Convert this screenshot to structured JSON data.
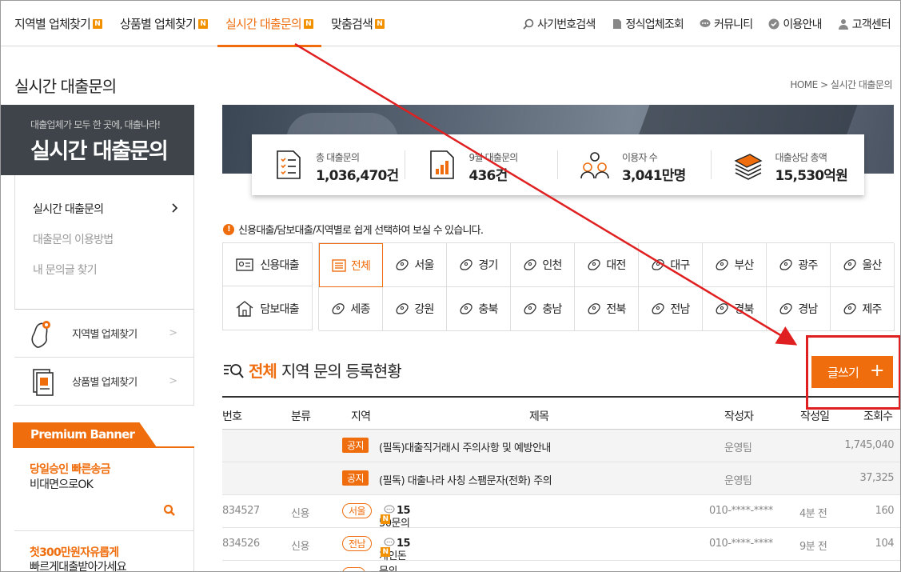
{
  "nav": {
    "main": [
      {
        "label": "지역별 업체찾기",
        "badge": "N"
      },
      {
        "label": "상품별 업체찾기",
        "badge": "N"
      },
      {
        "label": "실시간 대출문의",
        "badge": "N"
      },
      {
        "label": "맞춤검색",
        "badge": "N"
      }
    ],
    "utility": [
      "사기번호검색",
      "정식업체조회",
      "커뮤니티",
      "이용안내",
      "고객센터"
    ]
  },
  "page": {
    "title": "실시간 대출문의",
    "breadcrumb": "HOME > 실시간 대출문의"
  },
  "sidebar": {
    "hero_sub": "대출업체가 모두 한 곳에, 대출나라!",
    "hero_title": "실시간 대출문의",
    "menu": [
      "실시간 대출문의",
      "대출문의 이용방법",
      "내 문의글 찾기"
    ],
    "links": [
      "지역별 업체찾기",
      "상품별 업체찾기"
    ],
    "premium_label": "Premium Banner",
    "promos": [
      {
        "title": "당일승인 빠른송금",
        "sub": "비대면으로OK"
      },
      {
        "title": "첫300만원자유롭게",
        "sub": "빠르게대출받아가세요"
      }
    ]
  },
  "stats": [
    {
      "label": "총 대출문의",
      "value": "1,036,470건"
    },
    {
      "label": "9월 대출문의",
      "value": "436건"
    },
    {
      "label": "이용자 수",
      "value": "3,041만명"
    },
    {
      "label": "대출상담 총액",
      "value": "15,530억원"
    }
  ],
  "info_text": "신용대출/담보대출/지역별로 쉽게 선택하여 보실 수 있습니다.",
  "categories": [
    "신용대출",
    "담보대출"
  ],
  "regions": [
    "전체",
    "서울",
    "경기",
    "인천",
    "대전",
    "대구",
    "부산",
    "광주",
    "울산",
    "세종",
    "강원",
    "충북",
    "충남",
    "전북",
    "전남",
    "경북",
    "경남",
    "제주"
  ],
  "board": {
    "highlight": "전체",
    "title": "지역 문의 등록현황",
    "write_label": "글쓰기",
    "write_plus": "+"
  },
  "table": {
    "headers": [
      "번호",
      "분류",
      "지역",
      "제목",
      "작성자",
      "작성일",
      "조회수"
    ],
    "notices": [
      {
        "tag": "공지",
        "title": "(필독)대출직거래시 주의사항 및 예방안내",
        "author": "운영팀",
        "views": "1,745,040"
      },
      {
        "tag": "공지",
        "title": "(필독) 대출나라 사칭 스팸문자(전화) 주의",
        "author": "운영팀",
        "views": "37,325"
      }
    ],
    "rows": [
      {
        "no": "834527",
        "cat": "신용",
        "region": "서울",
        "title": "50문의",
        "comments": "15",
        "author": "010-****-****",
        "date": "4분 전",
        "views": "160"
      },
      {
        "no": "834526",
        "cat": "신용",
        "region": "전남",
        "title": "개인돈 문의",
        "comments": "15",
        "author": "010-****-****",
        "date": "9분 전",
        "views": "104"
      }
    ]
  },
  "colors": {
    "accent": "#ef6d0d",
    "annotation": "#e02020",
    "dark": "#3e4449"
  }
}
